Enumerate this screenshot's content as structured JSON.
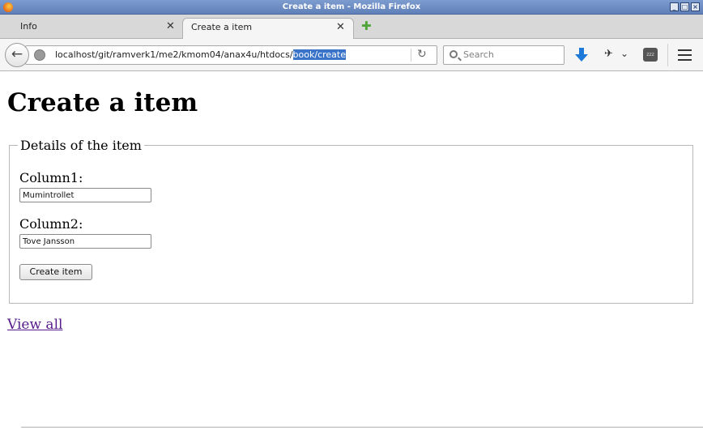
{
  "window": {
    "title": "Create a item - Mozilla Firefox"
  },
  "tabs": [
    {
      "label": "Info",
      "active": false
    },
    {
      "label": "Create a item",
      "active": true
    }
  ],
  "nav": {
    "url_prefix": "localhost/git/ramverk1/me2/kmom04/anax4u/htdocs/",
    "url_selected": "book/create",
    "search_placeholder": "Search"
  },
  "page": {
    "title": "Create a item",
    "fieldset_legend": "Details of the item",
    "fields": [
      {
        "label": "Column1:",
        "value": "Mumintrollet"
      },
      {
        "label": "Column2:",
        "value": "Tove Jansson"
      }
    ],
    "submit_label": "Create item",
    "link_view_all": "View all"
  },
  "colors": {
    "titlebar": "#6a8bc3",
    "link_visited": "#551a8b",
    "url_selection": "#3a74c8",
    "download_icon": "#1d79d8",
    "new_tab_icon": "#4fa53a"
  },
  "icons": [
    "firefox-icon",
    "close-icon",
    "new-tab-icon",
    "back-arrow-icon",
    "globe-icon",
    "reload-icon",
    "search-icon",
    "download-icon",
    "extension-icon",
    "chevron-down-icon",
    "tray-icon",
    "hamburger-menu-icon"
  ]
}
